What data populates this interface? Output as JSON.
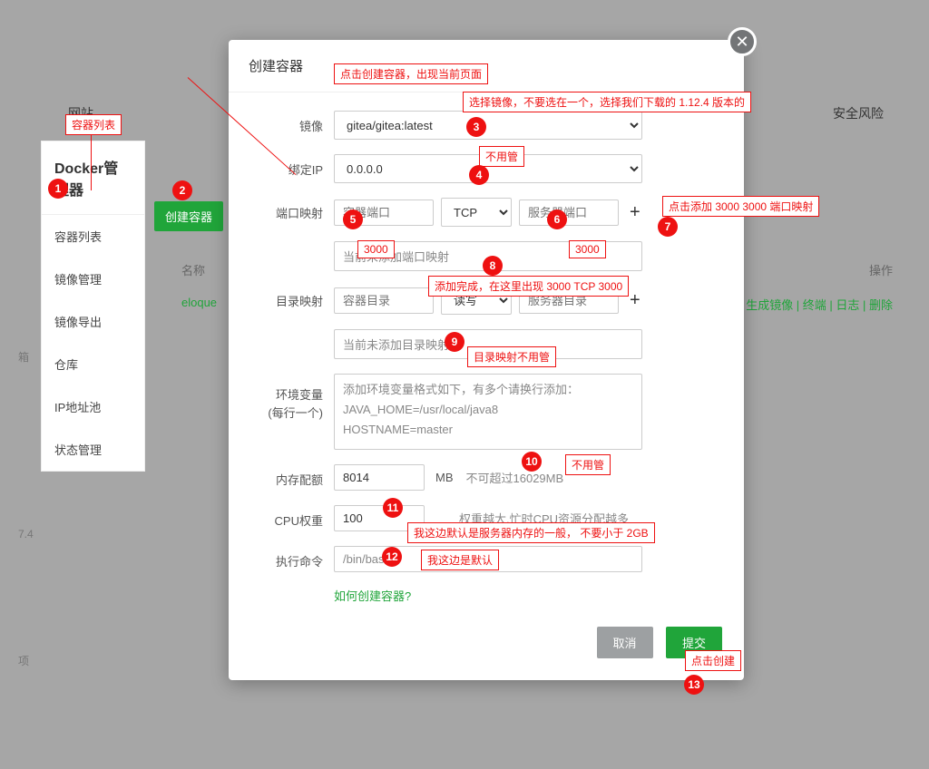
{
  "bg": {
    "top_tab": "网站",
    "right_tab": "安全风险",
    "panel_title": "Docker管理器",
    "sidebar": [
      "容器列表",
      "镜像管理",
      "镜像导出",
      "仓库",
      "IP地址池",
      "状态管理"
    ],
    "create_btn": "创建容器",
    "table_head_name": "名称",
    "table_head_ops": "操作",
    "row_name": "eloque",
    "row_ops": "生成镜像 | 终端 | 日志 | 删除",
    "v74": "7.4",
    "xiang": "项",
    "xiang2": "箱"
  },
  "modal": {
    "title": "创建容器",
    "labels": {
      "image": "镜像",
      "bind_ip": "绑定IP",
      "port_map": "端口映射",
      "port_empty": "当前未添加端口映射",
      "dir_map": "目录映射",
      "dir_empty": "当前未添加目录映射",
      "env": "环境变量",
      "env_sub": "(每行一个)",
      "mem": "内存配额",
      "mem_unit": "MB",
      "mem_hint": "不可超过16029MB",
      "cpu": "CPU权重",
      "cpu_hint": "权重越大,忙时CPU资源分配越多",
      "cmd": "执行命令",
      "how": "如何创建容器?",
      "cancel": "取消",
      "submit": "提交"
    },
    "image_value": "gitea/gitea:latest",
    "ip_value": "0.0.0.0",
    "protocol": "TCP",
    "port_container_ph": "容器端口",
    "port_server_ph": "服务器端口",
    "dir_rw": "读写",
    "dir_container_ph": "容器目录",
    "dir_server_ph": "服务器目录",
    "env_placeholder": "添加环境变量格式如下，有多个请换行添加：\nJAVA_HOME=/usr/local/java8\nHOSTNAME=master",
    "mem_value": "8014",
    "cpu_value": "100",
    "cmd_value": "/bin/bash"
  },
  "ann": {
    "a_top": "容器列表",
    "a_click_create": "点击创建容器，出现当前页面",
    "a_image": "选择镜像，不要选在一个，选择我们下载的 1.12.4 版本的",
    "a_nc1": "不用管",
    "a_add_port": "点击添加 3000 3000 端口映射",
    "a_3000a": "3000",
    "a_3000b": "3000",
    "a_port_done": "添加完成，在这里出现 3000  TCP   3000",
    "a_dir": "目录映射不用管",
    "a_nc2": "不用管",
    "a_mem": "我这边默认是服务器内存的一般，     不要小于 2GB",
    "a_cpu_def": "我这边是默认",
    "a_submit": "点击创建"
  }
}
